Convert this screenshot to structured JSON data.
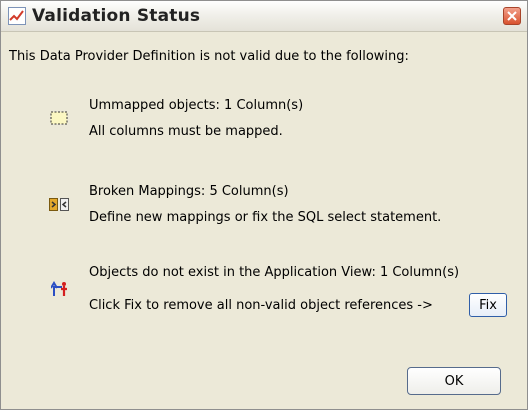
{
  "dialog": {
    "title": "Validation Status",
    "intro": "This Data Provider Definition is not valid due to the following:",
    "issues": [
      {
        "icon": "unmapped-object-icon",
        "heading": "Ummapped objects: 1 Column(s)",
        "detail": "All columns must be mapped."
      },
      {
        "icon": "broken-mapping-icon",
        "heading": "Broken Mappings: 5 Column(s)",
        "detail": "Define new mappings or fix the SQL select statement."
      },
      {
        "icon": "missing-object-icon",
        "heading": "Objects do not exist in the Application View: 1 Column(s)",
        "detail": "Click Fix to remove all non-valid object references ->"
      }
    ],
    "fix_label": "Fix",
    "ok_label": "OK"
  },
  "colors": {
    "window_bg": "#ece9d8",
    "close_button": "#d9532f",
    "fix_border": "#2f5ea8"
  }
}
